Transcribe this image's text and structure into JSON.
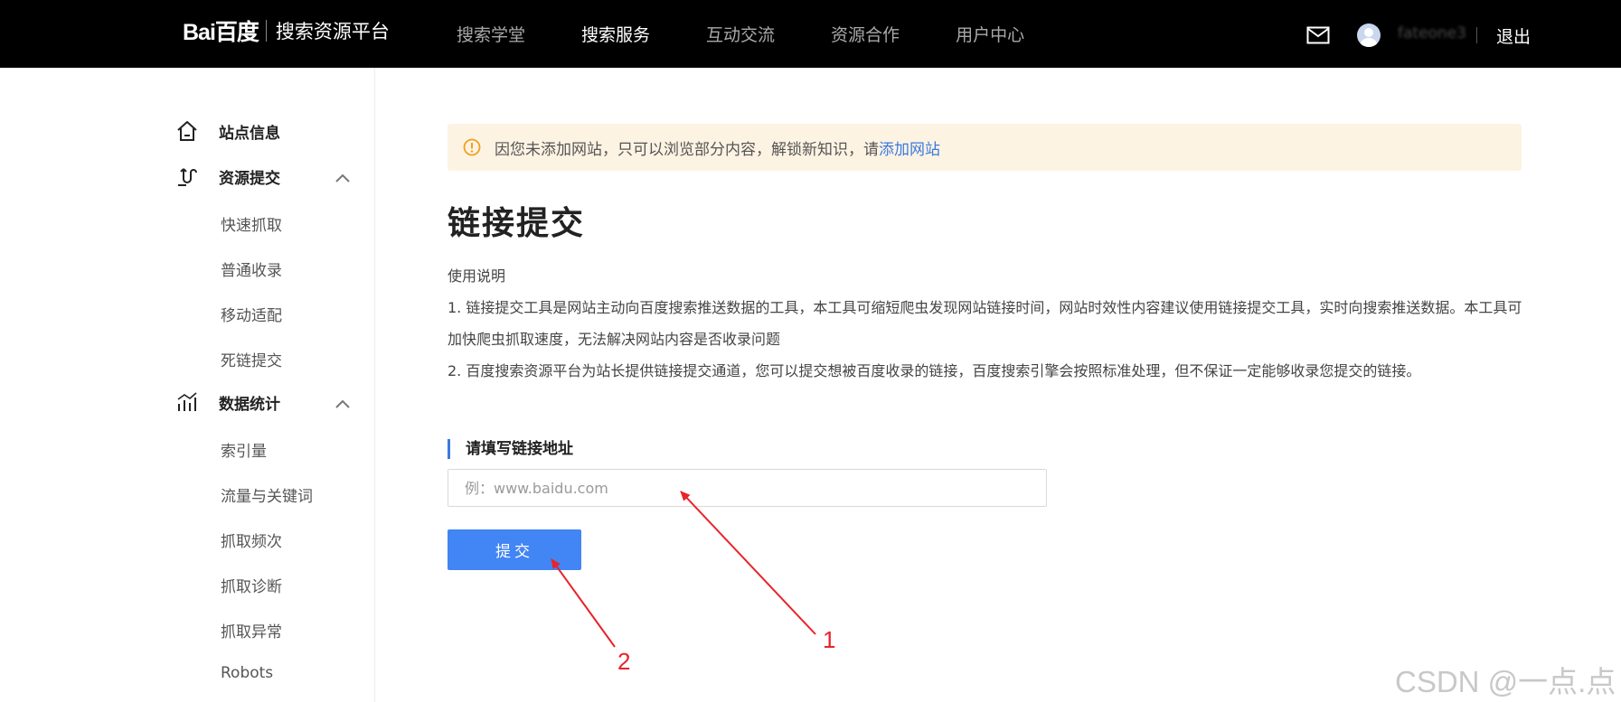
{
  "header": {
    "logo_text": "Bai百度",
    "logo_subtitle": "搜索资源平台",
    "nav": [
      {
        "label": "搜索学堂",
        "active": false
      },
      {
        "label": "搜索服务",
        "active": true
      },
      {
        "label": "互动交流",
        "active": false
      },
      {
        "label": "资源合作",
        "active": false
      },
      {
        "label": "用户中心",
        "active": false
      }
    ],
    "username": "fateone3",
    "logout_label": "退出",
    "icons": {
      "mail": "mail-icon",
      "avatar": "avatar-icon"
    }
  },
  "sidebar": {
    "site_info": {
      "label": "站点信息",
      "icon": "home-icon"
    },
    "resource_submit": {
      "label": "资源提交",
      "icon": "hook-icon",
      "items": [
        "快速抓取",
        "普通收录",
        "移动适配",
        "死链提交"
      ]
    },
    "data_stats": {
      "label": "数据统计",
      "icon": "chart-icon",
      "items": [
        "索引量",
        "流量与关键词",
        "抓取频次",
        "抓取诊断",
        "抓取异常",
        "Robots"
      ]
    }
  },
  "main": {
    "alert": {
      "text": "因您未添加网站，只可以浏览部分内容，解锁新知识，请",
      "link": "添加网站"
    },
    "title": "链接提交",
    "usage_heading": "使用说明",
    "usage_1": "1. 链接提交工具是网站主动向百度搜索推送数据的工具，本工具可缩短爬虫发现网站链接时间，网站时效性内容建议使用链接提交工具，实时向搜索推送数据。本工具可加快爬虫抓取速度，无法解决网站内容是否收录问题",
    "usage_2": "2. 百度搜索资源平台为站长提供链接提交通道，您可以提交想被百度收录的链接，百度搜索引擎会按照标准处理，但不保证一定能够收录您提交的链接。",
    "form_label": "请填写链接地址",
    "input_placeholder": "例：www.baidu.com",
    "submit_label": "提交"
  },
  "annotations": {
    "first": "1",
    "second": "2"
  },
  "watermark": "CSDN @一点.点",
  "colors": {
    "accent": "#4285f4",
    "alert_bg": "#fdf3e3",
    "alert_icon": "#f0a020",
    "annotation": "#e8232a"
  }
}
